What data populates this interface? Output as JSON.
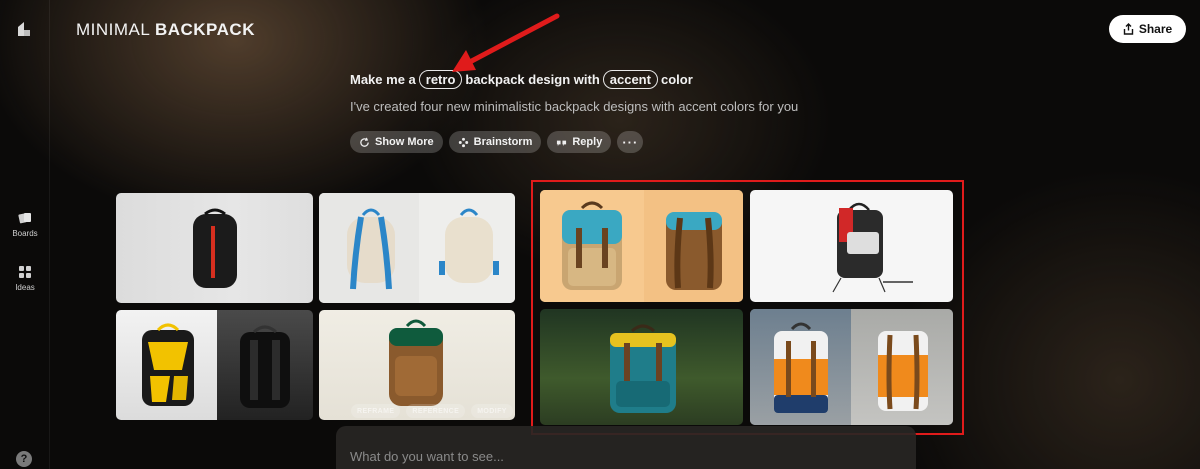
{
  "app": {
    "title_light": "MINIMAL",
    "title_bold": "BACKPACK",
    "share_label": "Share"
  },
  "sidebar": {
    "items": [
      {
        "label": "Boards",
        "icon": "boards-icon"
      },
      {
        "label": "Ideas",
        "icon": "ideas-icon"
      }
    ],
    "help_label": "?"
  },
  "prompt": {
    "prefix": "Make me a",
    "tag1": "retro",
    "middle": "backpack design with",
    "tag2": "accent",
    "suffix": "color",
    "response": "I've created four new minimalistic backpack designs with accent colors for you"
  },
  "actions": [
    {
      "label": "Show More",
      "icon": "refresh-icon"
    },
    {
      "label": "Brainstorm",
      "icon": "brainstorm-icon"
    },
    {
      "label": "Reply",
      "icon": "quote-icon"
    },
    {
      "label": "···",
      "icon": "more-icon"
    }
  ],
  "image_overlay_buttons": [
    "REFRAME",
    "REFERENCE",
    "MODIFY"
  ],
  "input": {
    "placeholder": "What do you want to see..."
  },
  "colors": {
    "highlight": "#e01b1b",
    "annotation_arrow": "#e01b1b"
  }
}
